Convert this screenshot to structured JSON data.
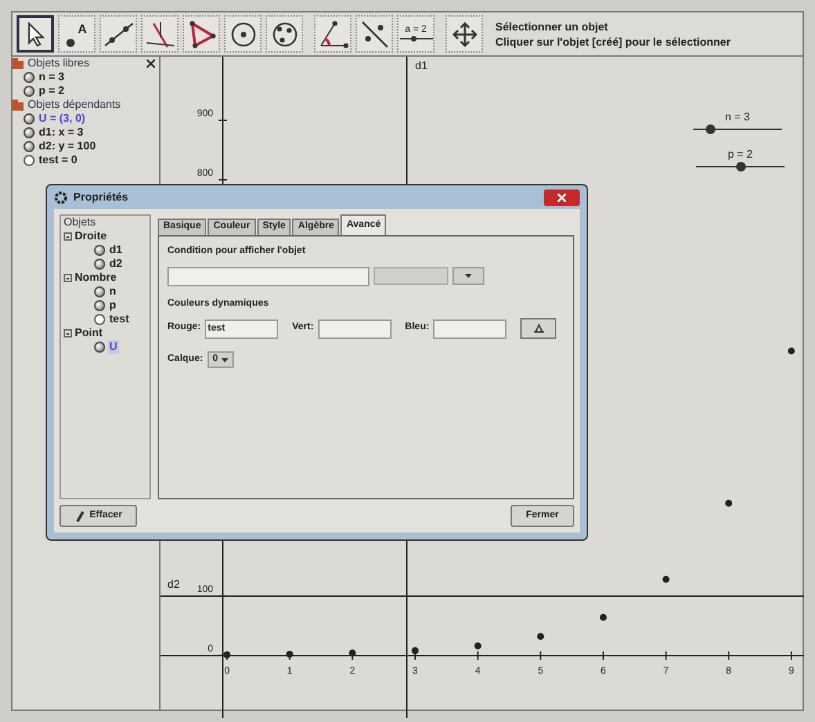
{
  "toolbar": {
    "tools": [
      {
        "kind": "pointer",
        "selected": true
      },
      {
        "kind": "point",
        "label": "A",
        "selected": false
      },
      {
        "kind": "line",
        "selected": false
      },
      {
        "kind": "perpendicular",
        "selected": false
      },
      {
        "kind": "polygon",
        "selected": false
      },
      {
        "kind": "circle",
        "selected": false
      },
      {
        "kind": "circle3",
        "selected": false
      },
      {
        "kind": "angle",
        "selected": false
      },
      {
        "kind": "reflect",
        "selected": false
      },
      {
        "kind": "slider",
        "label": "a = 2",
        "selected": false
      },
      {
        "kind": "move",
        "selected": false
      }
    ],
    "help_title": "Sélectionner un objet",
    "help_text": "Cliquer sur l'objet [créé] pour le sélectionner"
  },
  "algebra": {
    "groups": [
      {
        "title": "Objets libres",
        "items": [
          {
            "text": "n = 3",
            "visible": true,
            "selected": false
          },
          {
            "text": "p = 2",
            "visible": true,
            "selected": false
          }
        ]
      },
      {
        "title": "Objets dépendants",
        "items": [
          {
            "text": "U = (3, 0)",
            "visible": true,
            "selected": true
          },
          {
            "text": "d1: x = 3",
            "visible": true,
            "selected": false
          },
          {
            "text": "d2: y = 100",
            "visible": true,
            "selected": false
          },
          {
            "text": "test = 0",
            "visible": false,
            "selected": false
          }
        ]
      }
    ]
  },
  "graphics": {
    "line_labels": [
      "d1",
      "d2"
    ],
    "sliders": [
      {
        "label": "n = 3",
        "level": 0.18
      },
      {
        "label": "p = 2",
        "level": 0.5
      }
    ],
    "chart_data": {
      "type": "scatter",
      "x": [
        0,
        1,
        2,
        3,
        4,
        5,
        6,
        7,
        8,
        9
      ],
      "series": [
        {
          "color": "#222222",
          "values": [
            1,
            2,
            4,
            8,
            16,
            32,
            64,
            128,
            256,
            512
          ]
        }
      ],
      "xlim": [
        -1.06,
        9.2
      ],
      "ylim": [
        -105,
        1007
      ],
      "xticks": [
        0,
        1,
        2,
        3,
        4,
        5,
        6,
        7,
        8,
        9
      ],
      "yticks": [
        0,
        100,
        800,
        900
      ]
    }
  },
  "dialog": {
    "title": "Propriétés",
    "tree_header": "Objets",
    "tree": [
      {
        "label": "Droite",
        "children": [
          {
            "label": "d1",
            "visible": true,
            "selected": false
          },
          {
            "label": "d2",
            "visible": true,
            "selected": false
          }
        ]
      },
      {
        "label": "Nombre",
        "children": [
          {
            "label": "n",
            "visible": true,
            "selected": false
          },
          {
            "label": "p",
            "visible": true,
            "selected": false
          },
          {
            "label": "test",
            "visible": false,
            "selected": false
          }
        ]
      },
      {
        "label": "Point",
        "children": [
          {
            "label": "U",
            "visible": true,
            "selected": true
          }
        ]
      }
    ],
    "tabs": [
      {
        "label": "Basique",
        "selected": false
      },
      {
        "label": "Couleur",
        "selected": false
      },
      {
        "label": "Style",
        "selected": false
      },
      {
        "label": "Algèbre",
        "selected": false
      },
      {
        "label": "Avancé",
        "selected": true
      }
    ],
    "condition_title": "Condition pour afficher l'objet",
    "dynamic_title": "Couleurs dynamiques",
    "color_fields": [
      {
        "label": "Rouge:",
        "value": "test"
      },
      {
        "label": "Vert:"
      },
      {
        "label": "Bleu:"
      }
    ],
    "layer_label": "Calque:",
    "layer_value": "0",
    "delete_button": "Effacer",
    "close_button": "Fermer"
  }
}
